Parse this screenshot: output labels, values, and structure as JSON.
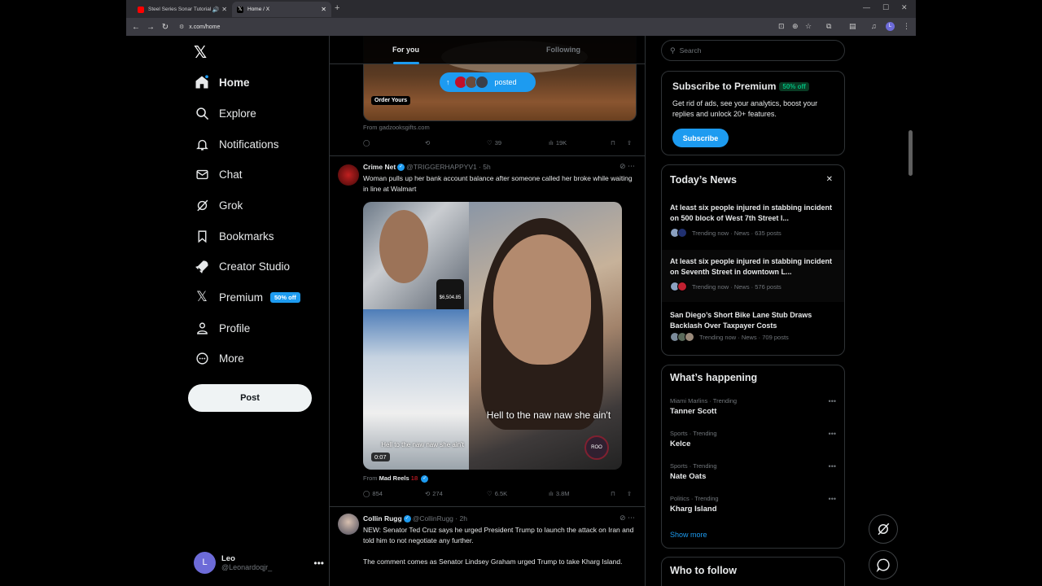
{
  "browser": {
    "tabs": [
      {
        "title": "Steel Series Sonar Tutorial",
        "active": false,
        "favicon_color": "#ff0000"
      },
      {
        "title": "Home / X",
        "active": true,
        "favicon_color": "#ffffff"
      }
    ],
    "url": "x.com/home",
    "profile_initial": "L"
  },
  "nav": {
    "logo": "𝕏",
    "items": [
      {
        "label": "Home",
        "icon": "home-icon",
        "active": true
      },
      {
        "label": "Explore",
        "icon": "search-icon"
      },
      {
        "label": "Notifications",
        "icon": "bell-icon"
      },
      {
        "label": "Chat",
        "icon": "mail-icon"
      },
      {
        "label": "Grok",
        "icon": "grok-icon"
      },
      {
        "label": "Bookmarks",
        "icon": "bookmark-icon"
      },
      {
        "label": "Creator Studio",
        "icon": "rocket-icon"
      },
      {
        "label": "Premium",
        "icon": "x-icon",
        "badge": "50% off"
      },
      {
        "label": "Profile",
        "icon": "person-icon"
      },
      {
        "label": "More",
        "icon": "more-circle-icon"
      }
    ],
    "post_label": "Post",
    "account": {
      "initial": "L",
      "name": "Leo",
      "handle": "@Leonardoqjr_"
    }
  },
  "timeline": {
    "tabs": {
      "for_you": "For you",
      "following": "Following"
    },
    "top_tweet": {
      "order_label": "Order Yours",
      "posted_pill": "posted",
      "from": "From gadzooksgifts.com",
      "actions": {
        "replies": "",
        "reposts": "",
        "likes": "39",
        "views": "19K"
      }
    },
    "tweet1": {
      "name": "Crime Net",
      "handle": "@TRIGGERHAPPYV1",
      "time": "5h",
      "text": "Woman pulls up her bank account balance after someone called her broke while waiting in line at Walmart",
      "phone_balance": "$6,504.85",
      "caption_big": "Hell to the naw naw she ain't",
      "caption_small": "Hell to the naw naw she ain't",
      "timestamp": "0:07",
      "watermark": "ROO",
      "from_prefix": "From",
      "from_name": "Mad Reels",
      "from_age": "18",
      "actions": {
        "replies": "854",
        "reposts": "274",
        "likes": "6.5K",
        "views": "3.8M"
      }
    },
    "tweet2": {
      "name": "Collin Rugg",
      "handle": "@CollinRugg",
      "time": "2h",
      "text1": "NEW: Senator Ted Cruz says he urged President Trump to launch the attack on Iran and told him to not negotiate any further.",
      "text2": "The comment comes as Senator Lindsey Graham urged Trump to take Kharg Island."
    }
  },
  "sidebar": {
    "search_placeholder": "Search",
    "premium": {
      "title": "Subscribe to Premium",
      "badge": "50% off",
      "desc": "Get rid of ads, see your analytics, boost your replies and unlock 20+ features.",
      "button": "Subscribe"
    },
    "news": {
      "title": "Today’s News",
      "close": "✕",
      "items": [
        {
          "headline": "At least six people injured in stabbing incident on 500 block of West 7th Street l...",
          "meta": "Trending now · News · 635 posts"
        },
        {
          "headline": "At least six people injured in stabbing incident on Seventh Street in downtown L...",
          "meta": "Trending now · News · 576 posts"
        },
        {
          "headline": "San Diego’s Short Bike Lane Stub Draws Backlash Over Taxpayer Costs",
          "meta": "Trending now · News · 709 posts"
        }
      ]
    },
    "happening": {
      "title": "What’s happening",
      "items": [
        {
          "category": "Miami Marlins · Trending",
          "topic": "Tanner Scott"
        },
        {
          "category": "Sports · Trending",
          "topic": "Kelce"
        },
        {
          "category": "Sports · Trending",
          "topic": "Nate Oats"
        },
        {
          "category": "Politics · Trending",
          "topic": "Kharg Island"
        }
      ],
      "show_more": "Show more"
    },
    "who_to_follow": "Who to follow"
  },
  "colors": {
    "accent": "#1d9bf0",
    "background": "#000000",
    "border": "#2f3336",
    "muted": "#71767b"
  }
}
